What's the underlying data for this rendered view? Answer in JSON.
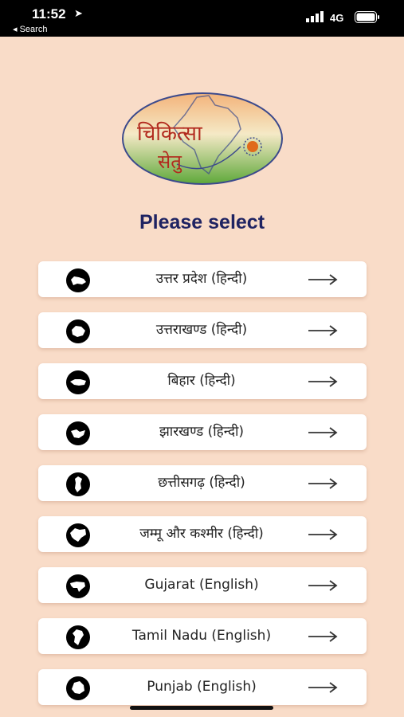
{
  "status_bar": {
    "time": "11:52",
    "back_label": "◂ Search",
    "network": "4G"
  },
  "logo": {
    "text_line1": "चिकित्सा",
    "text_line2": "सेतु"
  },
  "title": "Please select",
  "states": [
    {
      "label": "उत्तर प्रदेश (हिन्दी)",
      "icon": "uttar-pradesh-map-icon"
    },
    {
      "label": "उत्तराखण्ड (हिन्दी)",
      "icon": "uttarakhand-map-icon"
    },
    {
      "label": "बिहार (हिन्दी)",
      "icon": "bihar-map-icon"
    },
    {
      "label": "झारखण्ड (हिन्दी)",
      "icon": "jharkhand-map-icon"
    },
    {
      "label": "छत्तीसगढ़ (हिन्दी)",
      "icon": "chhattisgarh-map-icon"
    },
    {
      "label": "जम्मू और कश्मीर (हिन्दी)",
      "icon": "jammu-kashmir-map-icon"
    },
    {
      "label": "Gujarat (English)",
      "icon": "gujarat-map-icon"
    },
    {
      "label": "Tamil Nadu (English)",
      "icon": "tamil-nadu-map-icon"
    },
    {
      "label": "Punjab (English)",
      "icon": "punjab-map-icon"
    }
  ],
  "colors": {
    "background": "#f9dcc8",
    "title": "#1f2362",
    "card": "#ffffff"
  }
}
